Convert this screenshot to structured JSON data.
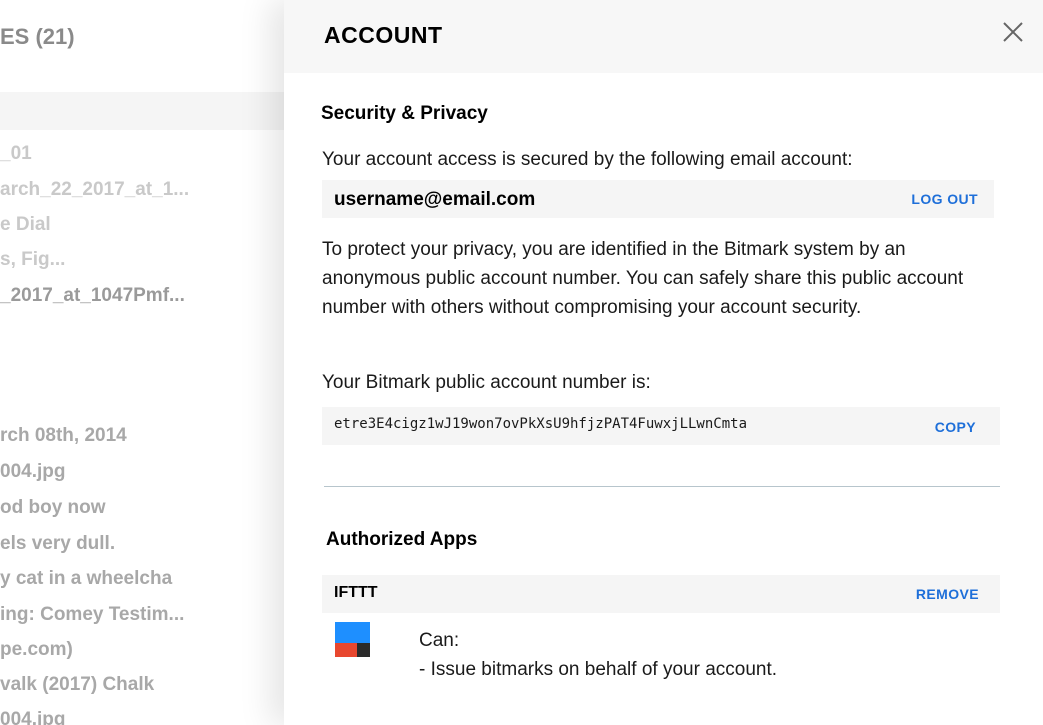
{
  "left": {
    "title": "ES (21)",
    "items": [
      {
        "text": "_01",
        "tone": "light"
      },
      {
        "text": "arch_22_2017_at_1...",
        "tone": "light"
      },
      {
        "text": "e Dial",
        "tone": "light"
      },
      {
        "text": "s, Fig...",
        "tone": "light"
      },
      {
        "text": "_2017_at_1047Pmf...",
        "tone": "dark"
      },
      {
        "text": "rch 08th, 2014",
        "tone": "mid"
      },
      {
        "text": "004.jpg",
        "tone": "mid"
      },
      {
        "text": "od boy now",
        "tone": "mid"
      },
      {
        "text": "els very dull.",
        "tone": "mid"
      },
      {
        "text": "y cat in a wheelcha",
        "tone": "mid"
      },
      {
        "text": "ing: Comey Testim...",
        "tone": "mid"
      },
      {
        "text": "pe.com)",
        "tone": "mid"
      },
      {
        "text": "valk (2017) Chalk",
        "tone": "mid"
      },
      {
        "text": "004.jpg",
        "tone": "mid"
      }
    ]
  },
  "panel": {
    "title": "ACCOUNT",
    "close_icon": "close-icon",
    "security": {
      "heading": "Security & Privacy",
      "email_intro": "Your account access is secured by the following email account:",
      "email": "username@email.com",
      "logout_label": "LOG OUT",
      "privacy_text": "To protect your privacy, you are identified in the Bitmark system by an anonymous public account number. You can safely share this public account number with others without compromising your account security.",
      "account_intro": "Your Bitmark public account number is:",
      "account_number": "etre3E4cigz1wJ19won7ovPkXsU9hfjzPAT4FuwxjLLwnCmta",
      "copy_label": "COPY"
    },
    "apps": {
      "heading": "Authorized Apps",
      "items": [
        {
          "name": "IFTTT",
          "remove_label": "REMOVE",
          "can_label": "Can:",
          "permission": "- Issue bitmarks on behalf of your account.",
          "logo_icon": "ifttt-logo-icon"
        }
      ]
    }
  },
  "colors": {
    "accent": "#1e6fd9",
    "logo_blue": "#1e8fff",
    "logo_red": "#e8472f",
    "logo_dark": "#2b2b2b"
  }
}
